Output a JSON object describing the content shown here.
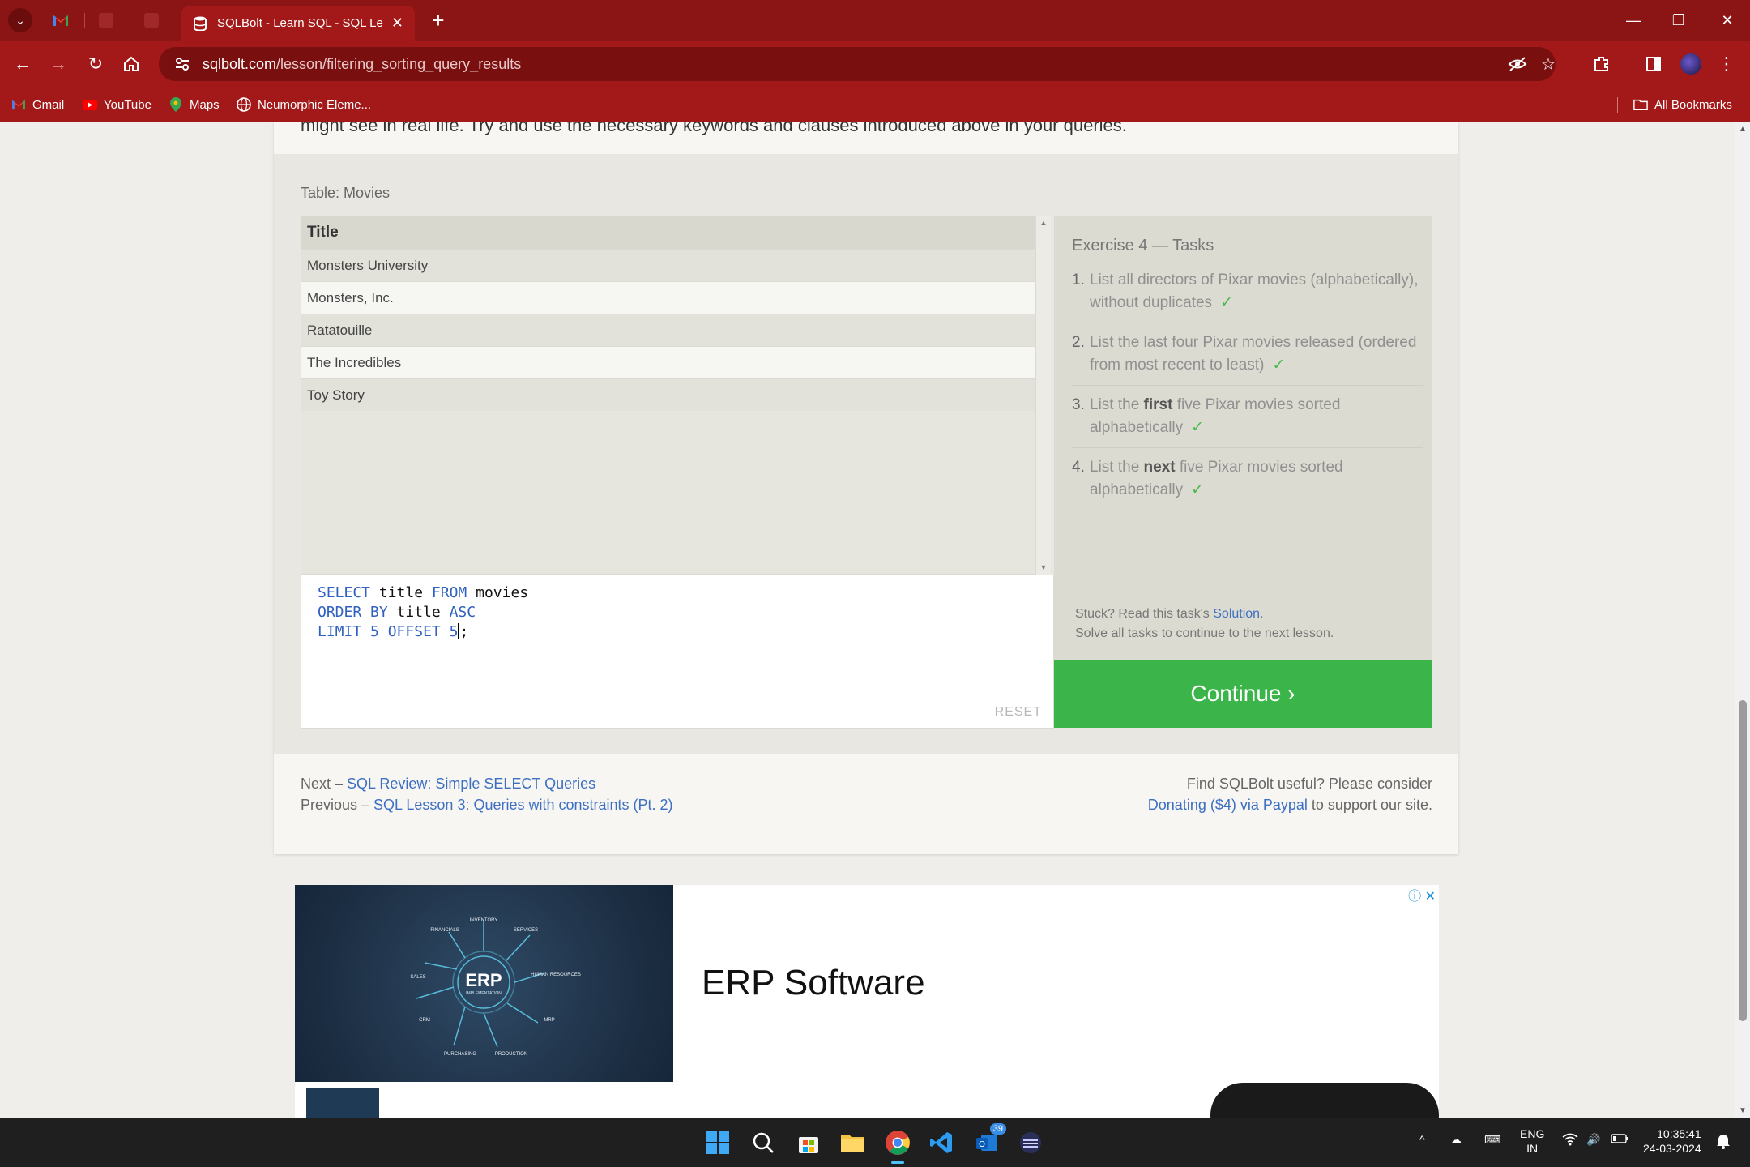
{
  "browser": {
    "active_tab_title": "SQLBolt - Learn SQL - SQL Less",
    "url_host": "sqlbolt.com",
    "url_path": "/lesson/filtering_sorting_query_results",
    "bookmarks": [
      "Gmail",
      "YouTube",
      "Maps",
      "Neumorphic Eleme..."
    ],
    "all_bookmarks": "All Bookmarks"
  },
  "page": {
    "intro_line": "might see in real life. Try and use the necessary keywords and clauses introduced above in your queries.",
    "table_caption": "Table: Movies",
    "results": {
      "header": "Title",
      "rows": [
        "Monsters University",
        "Monsters, Inc.",
        "Ratatouille",
        "The Incredibles",
        "Toy Story"
      ]
    },
    "editor": {
      "line1_kw": "SELECT",
      "line1_id": "title",
      "line1_kw2": "FROM",
      "line1_id2": "movies",
      "line2_kw": "ORDER BY",
      "line2_id": "title",
      "line2_kw2": "ASC",
      "line3_kw": "LIMIT",
      "line3_num": "5",
      "line3_kw2": "OFFSET",
      "line3_num2": "5",
      "line3_end": ";",
      "reset_label": "RESET"
    },
    "tasks": {
      "title": "Exercise 4 — Tasks",
      "items": [
        {
          "num": "1.",
          "pre": "List all directors of Pixar movies (alphabetically), without duplicates",
          "bold": "",
          "post": ""
        },
        {
          "num": "2.",
          "pre": "List the last four Pixar movies released (ordered from most recent to least)",
          "bold": "",
          "post": ""
        },
        {
          "num": "3.",
          "pre": "List the ",
          "bold": "first",
          "post": " five Pixar movies sorted alphabetically"
        },
        {
          "num": "4.",
          "pre": "List the ",
          "bold": "next",
          "post": " five Pixar movies sorted alphabetically"
        }
      ],
      "check": "✓",
      "stuck_prefix": "Stuck? Read this task's ",
      "stuck_link": "Solution",
      "stuck_suffix": ".",
      "solve_all": "Solve all tasks to continue to the next lesson."
    },
    "continue_label": "Continue ›",
    "footer": {
      "next_prefix": "Next – ",
      "next_link": "SQL Review: Simple SELECT Queries",
      "prev_prefix": "Previous – ",
      "prev_link": "SQL Lesson 3: Queries with constraints (Pt. 2)",
      "useful_line": "Find SQLBolt useful? Please consider",
      "donate_link": "Donating ($4) via Paypal",
      "donate_suffix": " to support our site."
    }
  },
  "ad": {
    "headline": "ERP Software",
    "image_center": "ERP",
    "image_sub": "IMPLEMENTATION",
    "image_labels": [
      "FINANCIALS",
      "INVENTORY",
      "SERVICES",
      "SALES",
      "HUMAN RESOURCES",
      "CRM",
      "MRP",
      "PURCHASING",
      "PRODUCTION"
    ],
    "choices_icon": "ⓘ ✕"
  },
  "taskbar": {
    "lang": "ENG",
    "region": "IN",
    "time": "10:35:41",
    "date": "24-03-2024",
    "mail_badge": "39"
  },
  "colors": {
    "browser_frame": "#8b1414",
    "toolbar": "#a31818",
    "continue_green": "#3bb54a",
    "link_blue": "#3d6fc2",
    "sql_keyword": "#3060c0"
  }
}
